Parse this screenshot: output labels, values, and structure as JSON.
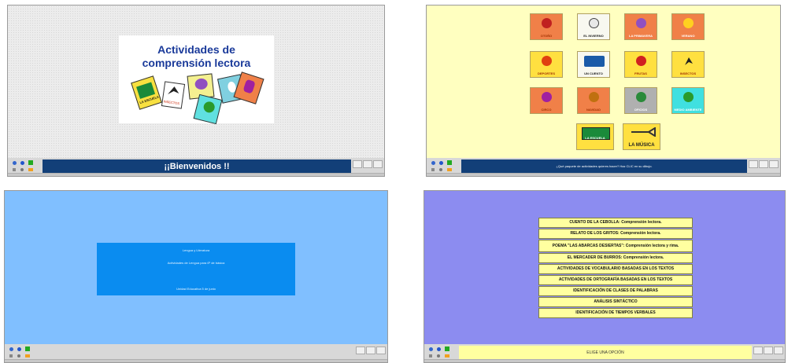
{
  "screens": {
    "welcome": {
      "title_line1": "Actividades de",
      "title_line2": "comprensión lectora",
      "cards": [
        "LA ESCUELA",
        "INSECTOS"
      ],
      "message": "¡¡Bienvenidos !!"
    },
    "activities_grid": {
      "tiles": [
        "OTOÑO",
        "EL INVIERNO",
        "LA PRIMAVERA",
        "VERANO",
        "DEPORTES",
        "UN CUENTO",
        "FRUTAS",
        "INSECTOS",
        "CIRCO",
        "NAVIDAD",
        "OFICIOS",
        "MEDIO AMBIENTE",
        "LA ESCUELA",
        "LA MÚSICA"
      ],
      "message": "¿Qué paquete de actividades quieres hacer? Haz CLIC en su dibujo."
    },
    "info": {
      "line1": "Lengua y Literatura",
      "line2": "Actividades de Lengua para 6º de básica",
      "line3": "Unidad Educativa 5 de junio"
    },
    "menu": {
      "items": [
        "CUENTO DE LA CEBOLLA: Comprensión lectora.",
        "RELATO DE LOS GRITOS: Comprensión lectora.",
        "POEMA \"LAS ABARCAS DESIERTAS\": Comprensión lectora y rima.",
        "EL MERCADER DE BURROS: Comprensión lectora.",
        "ACTIVIDADES DE VOCABULARIO BASADAS EN LOS TEXTOS",
        "ACTIVIDADES DE ORTOGRAFÍA BASADAS EN LOS TEXTOS",
        "IDENTIFICACIÓN DE CLASES DE PALABRAS",
        "ANÁLISIS SINTÁCTICO",
        "IDENTIFICACIÓN DE TIEMPOS VERBALES"
      ],
      "message": "ELIGE UNA OPCIÓN"
    }
  },
  "colors": {
    "welcome_bg": "#ececec",
    "grid_bg": "#ffffc0",
    "info_bg": "#80bfff",
    "menu_bg": "#8c8cf0",
    "message_bar": "#123f78",
    "menu_item": "#ffffa0"
  },
  "icons": [
    "play-icon",
    "next-icon",
    "info-icon",
    "help-icon",
    "sound-icon",
    "menu-icon"
  ]
}
